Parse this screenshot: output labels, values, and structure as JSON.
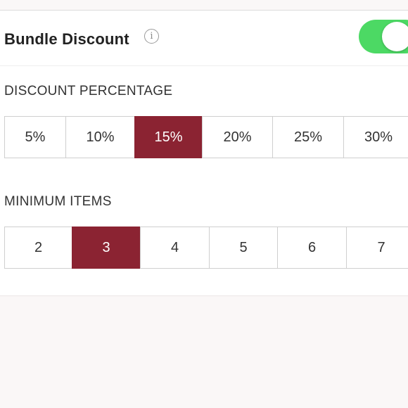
{
  "bundle": {
    "title": "Bundle Discount",
    "info_icon": "info-icon",
    "toggle_on": true,
    "toggle_color": "#4cd964"
  },
  "discount": {
    "label": "DISCOUNT PERCENTAGE",
    "options": [
      "5%",
      "10%",
      "15%",
      "20%",
      "25%",
      "30%"
    ],
    "selected": "15%"
  },
  "minimum": {
    "label": "MINIMUM ITEMS",
    "options": [
      "2",
      "3",
      "4",
      "5",
      "6",
      "7"
    ],
    "selected": "3"
  },
  "colors": {
    "selected_segment": "#8b2332",
    "toggle_on": "#4cd964"
  }
}
